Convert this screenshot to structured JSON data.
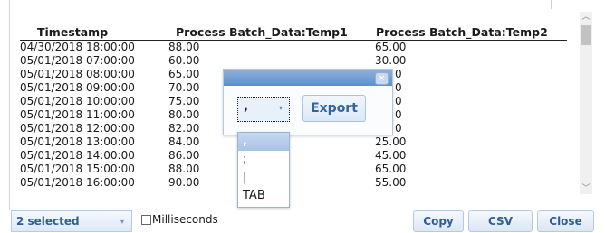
{
  "grid": {
    "columns": [
      "Timestamp",
      "Process Batch_Data:Temp1",
      "Process Batch_Data:Temp2"
    ],
    "rows": [
      [
        "04/30/2018 18:00:00",
        "88.00",
        "65.00"
      ],
      [
        "05/01/2018 07:00:00",
        "60.00",
        "30.00"
      ],
      [
        "05/01/2018 08:00:00",
        "65.00",
        "0"
      ],
      [
        "05/01/2018 09:00:00",
        "70.00",
        "0"
      ],
      [
        "05/01/2018 10:00:00",
        "75.00",
        "0"
      ],
      [
        "05/01/2018 11:00:00",
        "80.00",
        "0"
      ],
      [
        "05/01/2018 12:00:00",
        "82.00",
        "0"
      ],
      [
        "05/01/2018 13:00:00",
        "84.00",
        "25.00"
      ],
      [
        "05/01/2018 14:00:00",
        "86.00",
        "45.00"
      ],
      [
        "05/01/2018 15:00:00",
        "88.00",
        "65.00"
      ],
      [
        "05/01/2018 16:00:00",
        "90.00",
        "55.00"
      ]
    ],
    "scroll_up_icon": "chevron-up-icon",
    "scroll_down_icon": "chevron-down-icon"
  },
  "export_dialog": {
    "close_icon": "×",
    "separator_value": ",",
    "dropdown_caret": "▾",
    "export_label": "Export"
  },
  "separator_options": [
    ",",
    ";",
    "|",
    "TAB"
  ],
  "bottom_bar": {
    "selection_label": "2 selected",
    "selection_caret": "▾",
    "milliseconds_label": "Milliseconds",
    "milliseconds_checked": false,
    "copy_label": "Copy",
    "csv_label": "CSV",
    "close_label": "Close"
  }
}
